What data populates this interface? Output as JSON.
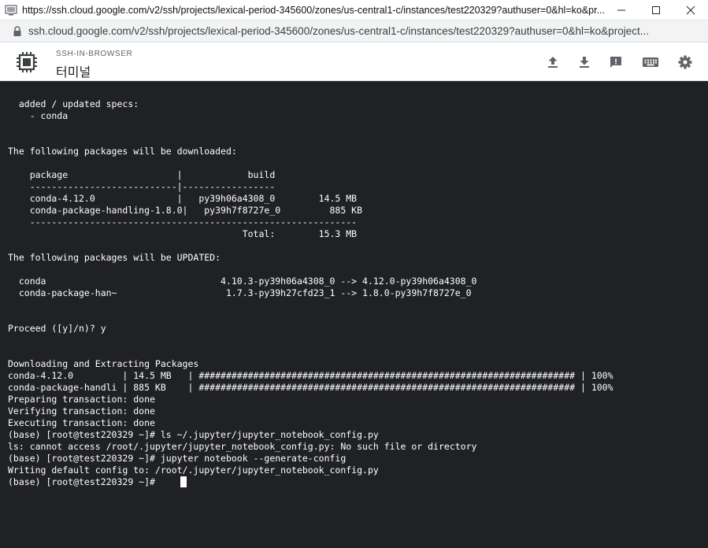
{
  "window": {
    "title": "https://ssh.cloud.google.com/v2/ssh/projects/lexical-period-345600/zones/us-central1-c/instances/test220329?authuser=0&hl=ko&pr..."
  },
  "address_bar": {
    "url": "ssh.cloud.google.com/v2/ssh/projects/lexical-period-345600/zones/us-central1-c/instances/test220329?authuser=0&hl=ko&project..."
  },
  "header": {
    "subtitle": "SSH-IN-BROWSER",
    "title": "터미널",
    "icons": [
      "upload-icon",
      "download-icon",
      "feedback-icon",
      "keyboard-icon",
      "settings-icon"
    ]
  },
  "terminal": {
    "lines": [
      "",
      "  added / updated specs:",
      "    - conda",
      "",
      "",
      "The following packages will be downloaded:",
      "",
      "    package                    |            build",
      "    ---------------------------|-----------------",
      "    conda-4.12.0               |   py39h06a4308_0        14.5 MB",
      "    conda-package-handling-1.8.0|   py39h7f8727e_0         885 KB",
      "    ------------------------------------------------------------",
      "                                           Total:        15.3 MB",
      "",
      "The following packages will be UPDATED:",
      "",
      "  conda                                4.10.3-py39h06a4308_0 --> 4.12.0-py39h06a4308_0",
      "  conda-package-han~                    1.7.3-py39h27cfd23_1 --> 1.8.0-py39h7f8727e_0",
      "",
      "",
      "Proceed ([y]/n)? y",
      "",
      "",
      "Downloading and Extracting Packages",
      "conda-4.12.0         | 14.5 MB   | ##################################################################### | 100%",
      "conda-package-handli | 885 KB    | ##################################################################### | 100%",
      "Preparing transaction: done",
      "Verifying transaction: done",
      "Executing transaction: done",
      "(base) [root@test220329 ~]# ls ~/.jupyter/jupyter_notebook_config.py",
      "ls: cannot access /root/.jupyter/jupyter_notebook_config.py: No such file or directory",
      "(base) [root@test220329 ~]# jupyter notebook --generate-config",
      "Writing default config to: /root/.jupyter/jupyter_notebook_config.py",
      "(base) [root@test220329 ~]# "
    ]
  }
}
